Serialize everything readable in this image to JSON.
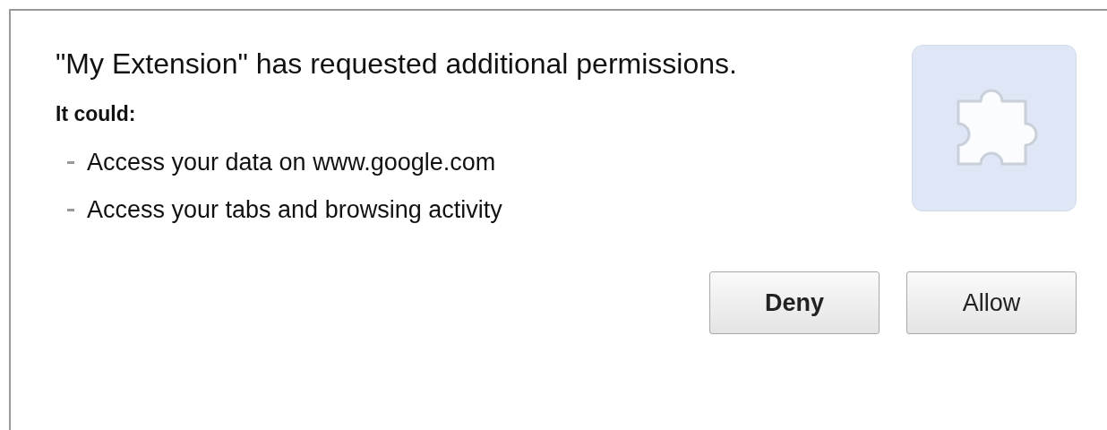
{
  "dialog": {
    "title": "\"My Extension\" has requested additional permissions.",
    "subtitle": "It could:",
    "permissions": [
      {
        "text": "Access your data on www.google.com"
      },
      {
        "text": "Access your tabs and browsing activity"
      }
    ],
    "buttons": [
      {
        "label": "Deny",
        "default": true
      },
      {
        "label": "Allow",
        "default": false
      }
    ]
  }
}
